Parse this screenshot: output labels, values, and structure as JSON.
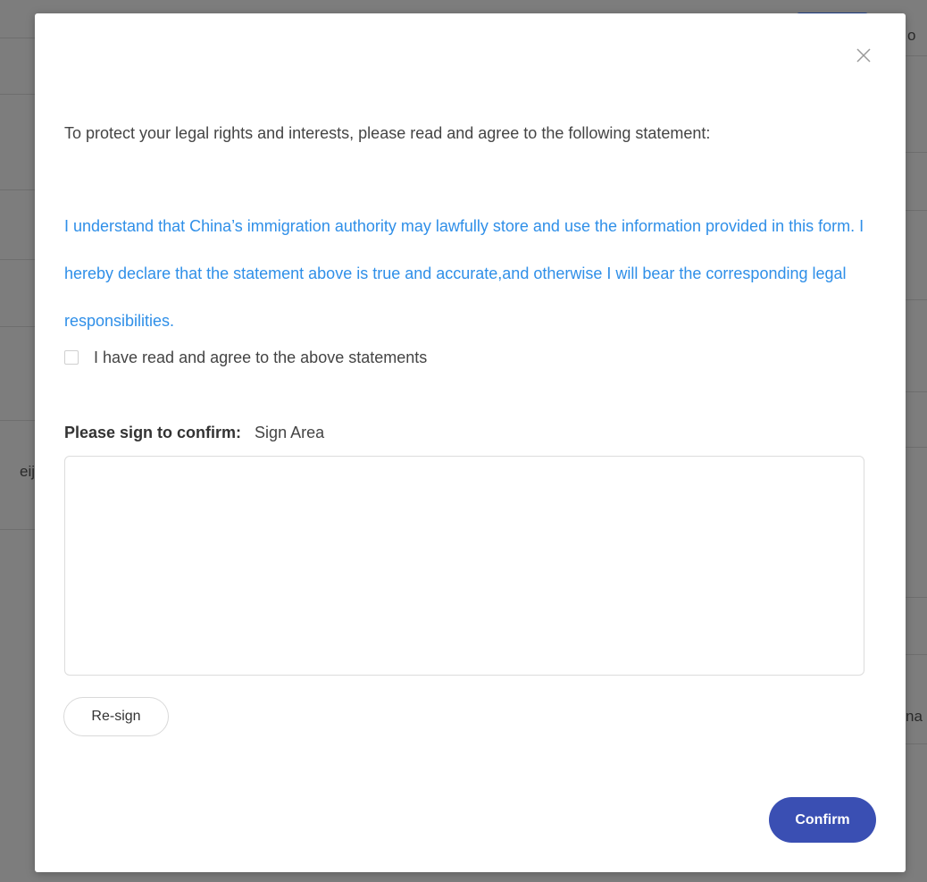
{
  "background": {
    "fragments": [
      "o",
      "eij",
      "na"
    ]
  },
  "modal": {
    "intro_text": "To protect your legal rights and interests, please read and agree to the following statement:",
    "statement_text": "I understand that China’s immigration authority may lawfully store and use the information provided in this form. I hereby declare that the statement above is true and accurate,and otherwise I will bear the corresponding legal responsibilities.",
    "agree_label": "I have read and agree to the above statements",
    "agree_checked": false,
    "sign_label": "Please sign to confirm:",
    "sign_area_label": "Sign Area",
    "resign_label": "Re-sign",
    "confirm_label": "Confirm",
    "close_icon": "close-icon"
  },
  "colors": {
    "statement_blue": "#2f8fe8",
    "confirm_button": "#3a4fb3",
    "overlay": "#7d7d7d"
  }
}
